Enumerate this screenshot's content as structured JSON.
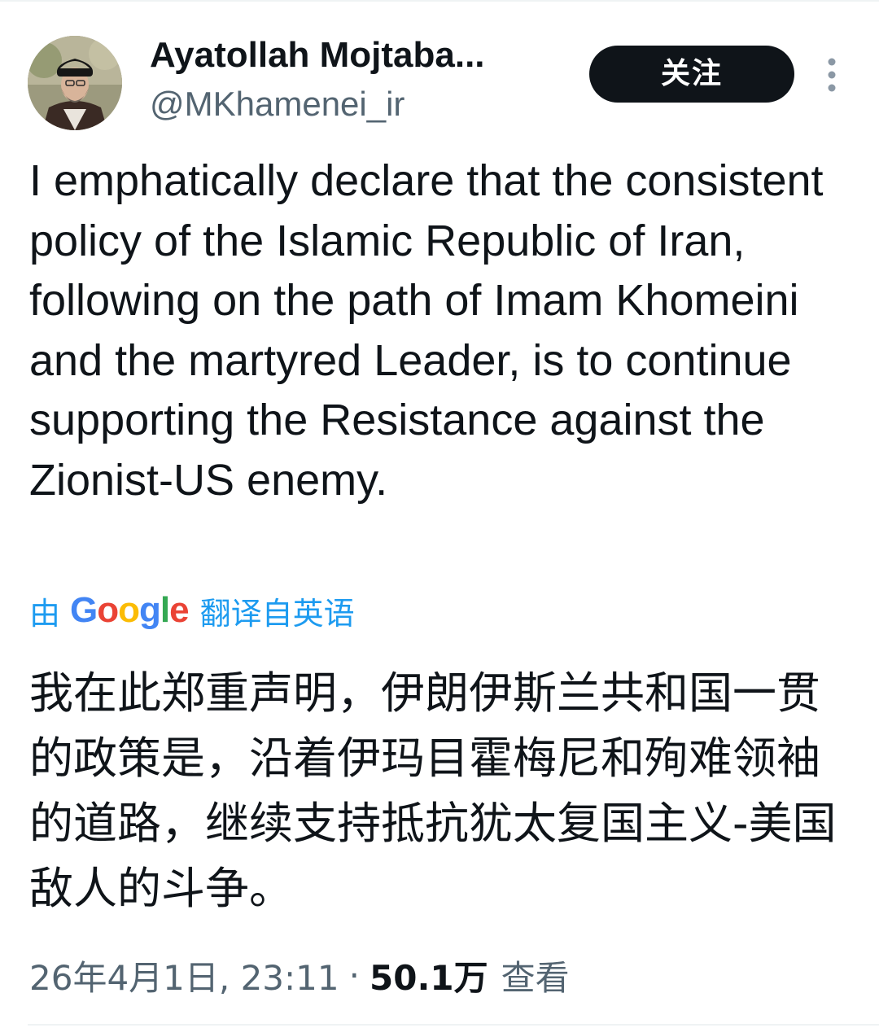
{
  "author": {
    "display_name": "Ayatollah Mojtaba...",
    "handle": "@MKhamenei_ir",
    "avatar_icon": "profile-photo"
  },
  "header": {
    "follow_label": "关注",
    "more_icon": "more-vertical-icon"
  },
  "tweet": {
    "text": "I emphatically declare that the consistent policy of the Islamic Republic of Iran, following on the path of Imam Khomeini and the martyred Leader, is to continue supporting the Resistance against the Zionist-US enemy."
  },
  "translation": {
    "prefix": "由",
    "provider": "Google",
    "suffix": "翻译自英语",
    "text": "我在此郑重声明，伊朗伊斯兰共和国一贯的政策是，沿着伊玛目霍梅尼和殉难领袖的道路，继续支持抵抗犹太复国主义-美国敌人的斗争。"
  },
  "meta": {
    "timestamp": "26年4月1日, 23:11",
    "separator": "·",
    "views_count": "50.1万",
    "views_label": "查看"
  },
  "colors": {
    "text_primary": "#0f1419",
    "text_secondary": "#536471",
    "link_blue": "#1d9bf0",
    "button_bg": "#0f1419",
    "divider": "#eff3f4"
  }
}
